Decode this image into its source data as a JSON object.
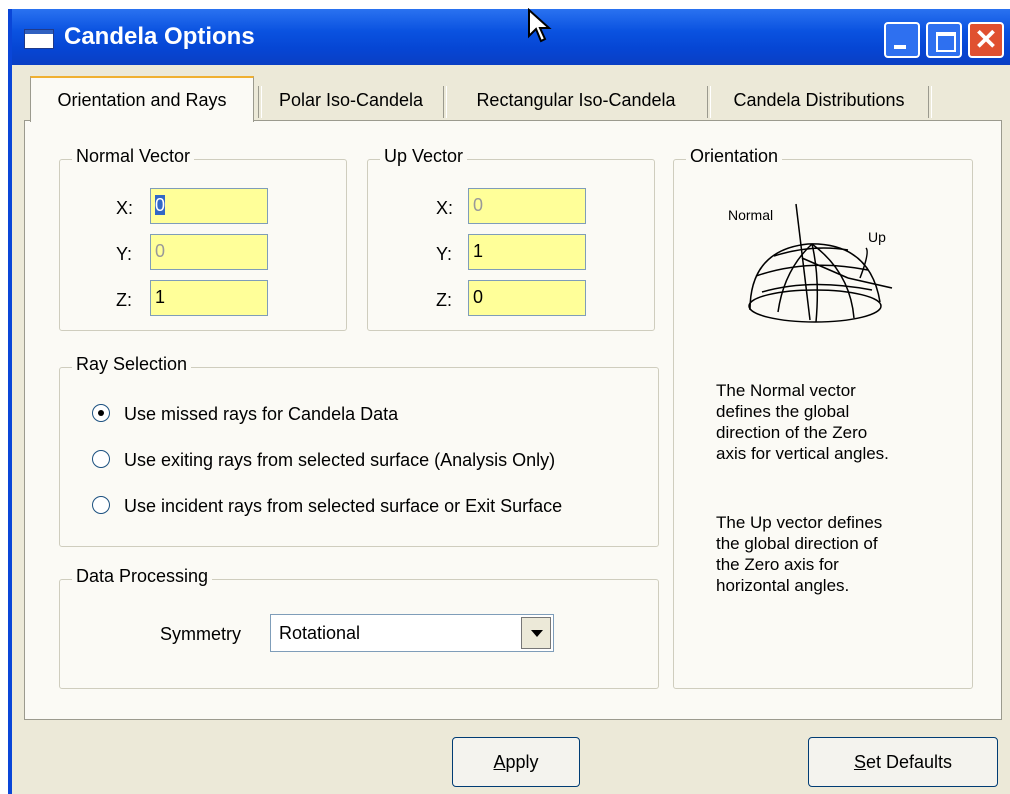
{
  "window": {
    "title": "Candela Options"
  },
  "tabs": [
    {
      "label": "Orientation and Rays",
      "active": true
    },
    {
      "label": "Polar Iso-Candela",
      "active": false
    },
    {
      "label": "Rectangular Iso-Candela",
      "active": false
    },
    {
      "label": "Candela Distributions",
      "active": false
    }
  ],
  "normal_vector": {
    "title": "Normal Vector",
    "x_label": "X:",
    "x_value": "0",
    "y_label": "Y:",
    "y_value": "0",
    "z_label": "Z:",
    "z_value": "1"
  },
  "up_vector": {
    "title": "Up Vector",
    "x_label": "X:",
    "x_value": "0",
    "y_label": "Y:",
    "y_value": "1",
    "z_label": "Z:",
    "z_value": "0"
  },
  "ray_selection": {
    "title": "Ray Selection",
    "options": [
      {
        "label": "Use missed rays for Candela Data",
        "selected": true
      },
      {
        "label": "Use exiting rays from selected surface (Analysis Only)",
        "selected": false
      },
      {
        "label": "Use incident rays from selected surface or Exit Surface",
        "selected": false
      }
    ]
  },
  "data_processing": {
    "title": "Data Processing",
    "symmetry_label": "Symmetry",
    "symmetry_value": "Rotational"
  },
  "orientation": {
    "title": "Orientation",
    "diagram_normal_label": "Normal",
    "diagram_up_label": "Up",
    "text_normal": "The Normal vector\ndefines the global\ndirection of the Zero\naxis for vertical angles.",
    "text_up": "The Up vector defines\nthe global direction of\nthe Zero axis for\nhorizontal angles."
  },
  "buttons": {
    "apply_mnemonic": "A",
    "apply_rest": "pply",
    "defaults_mnemonic": "S",
    "defaults_rest": "et Defaults"
  }
}
